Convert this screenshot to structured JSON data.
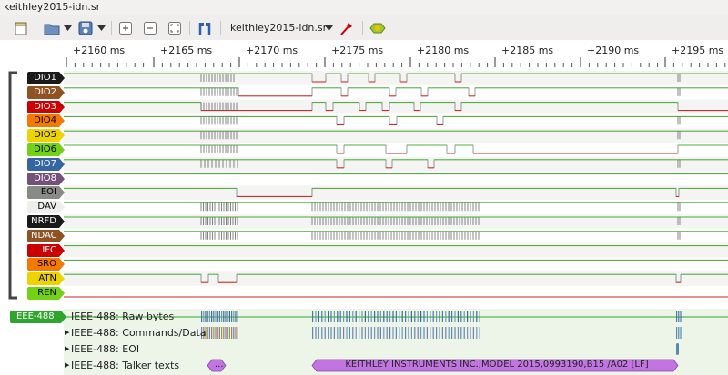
{
  "window": {
    "title": "keithley2015-idn.sr"
  },
  "toolbar": {
    "session_name": "keithley2015-idn.sr",
    "icons": [
      "new-view-icon",
      "open-file-icon",
      "save-file-icon",
      "zoom-in-icon",
      "zoom-out-icon",
      "zoom-fit-icon",
      "cursor-icon",
      "session-dropdown-icon",
      "probe-icon",
      "decoder-icon"
    ]
  },
  "ruler": {
    "ticks": [
      "+2160 ms",
      "+2165 ms",
      "+2170 ms",
      "+2175 ms",
      "+2180 ms",
      "+2185 ms",
      "+2190 ms",
      "+2195 ms"
    ]
  },
  "channels": [
    {
      "name": "DIO1",
      "bg": "#1a1a1a",
      "fg": "#ffffff"
    },
    {
      "name": "DIO2",
      "bg": "#8f5222",
      "fg": "#ffffff"
    },
    {
      "name": "DIO3",
      "bg": "#cc0000",
      "fg": "#ffffff"
    },
    {
      "name": "DIO4",
      "bg": "#f57900",
      "fg": "#000000"
    },
    {
      "name": "DIO5",
      "bg": "#edd400",
      "fg": "#000000"
    },
    {
      "name": "DIO6",
      "bg": "#73d216",
      "fg": "#000000"
    },
    {
      "name": "DIO7",
      "bg": "#3465a4",
      "fg": "#ffffff"
    },
    {
      "name": "DIO8",
      "bg": "#75507b",
      "fg": "#ffffff"
    },
    {
      "name": "EOI",
      "bg": "#888a85",
      "fg": "#000000"
    },
    {
      "name": "DAV",
      "bg": "#eeeeec",
      "fg": "#000000"
    },
    {
      "name": "NRFD",
      "bg": "#1a1a1a",
      "fg": "#ffffff"
    },
    {
      "name": "NDAC",
      "bg": "#8f5222",
      "fg": "#ffffff"
    },
    {
      "name": "IFC",
      "bg": "#cc0000",
      "fg": "#ffffff"
    },
    {
      "name": "SRO",
      "bg": "#f57900",
      "fg": "#000000"
    },
    {
      "name": "ATN",
      "bg": "#edd400",
      "fg": "#000000"
    },
    {
      "name": "REN",
      "bg": "#73d216",
      "fg": "#000000"
    }
  ],
  "decoder": {
    "name": "IEEE-488",
    "color": "#2ea62e",
    "rows": [
      {
        "label": "IEEE-488: Raw bytes",
        "expandable": false
      },
      {
        "label": "IEEE-488: Commands/Data",
        "expandable": true
      },
      {
        "label": "IEEE-488: EOI",
        "expandable": true
      },
      {
        "label": "IEEE-488: Talker texts",
        "expandable": true
      }
    ],
    "talker_short": "...",
    "talker_text": "KEITHLEY INSTRUMENTS INC.,MODEL 2015,0993190,B15  /A02  [LF]"
  },
  "colors": {
    "signal_high": "#4caf3a",
    "signal_low": "#cc2020",
    "decode_bg": "#ecf5e8",
    "annotation": "#c275e0"
  }
}
